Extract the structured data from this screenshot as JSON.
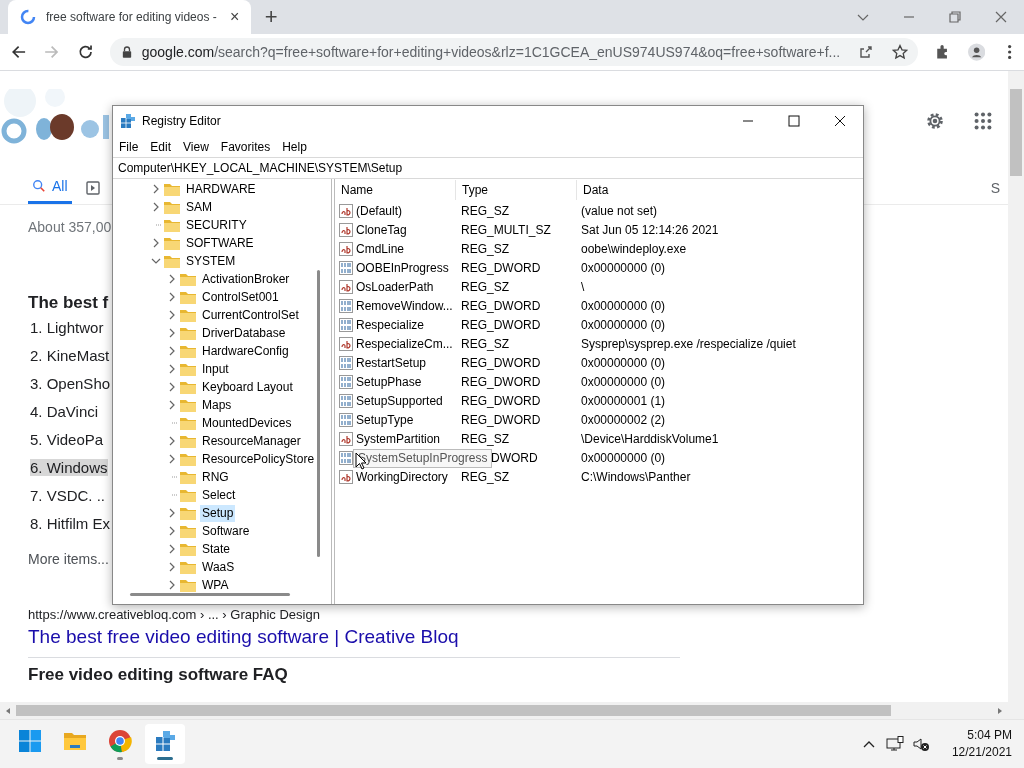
{
  "browser": {
    "tab": {
      "title": "free software for editing videos -",
      "close": "×"
    },
    "new_tab": "+",
    "forward_disabled": true,
    "address": {
      "host": "google.com",
      "path": "/search?q=free+software+for+editing+videos&rlz=1C1GCEA_enUS974US974&oq=free+software+f..."
    }
  },
  "google": {
    "tabs": [
      {
        "label": "All",
        "selected": true
      }
    ],
    "cut_tab": "S",
    "result_count": "About 357,00",
    "heading": "The best f",
    "list": [
      "1. Lightwor",
      "2. KineMast",
      "3. OpenSho",
      "4. DaVinci",
      "5. VideoPa",
      "6. Windows",
      "7. VSDC. ..",
      "8. Hitfilm Ex"
    ],
    "highlighted": [
      false,
      false,
      false,
      false,
      false,
      true,
      false,
      false
    ],
    "more": "More items...",
    "url": "https://www.creativebloq.com › ... › Graphic Design",
    "link": "The best free video editing software | Creative Bloq",
    "faq": "Free video editing software FAQ"
  },
  "regedit": {
    "title": "Registry Editor",
    "menu": [
      "File",
      "Edit",
      "View",
      "Favorites",
      "Help"
    ],
    "address": "Computer\\HKEY_LOCAL_MACHINE\\SYSTEM\\Setup",
    "tree": [
      {
        "label": "HARDWARE",
        "expandable": true,
        "expanded": false,
        "selected": false
      },
      {
        "label": "SAM",
        "expandable": true,
        "expanded": false,
        "selected": false
      },
      {
        "label": "SECURITY",
        "expandable": false,
        "expanded": false,
        "selected": false
      },
      {
        "label": "SOFTWARE",
        "expandable": true,
        "expanded": false,
        "selected": false
      },
      {
        "label": "SYSTEM",
        "expandable": true,
        "expanded": true,
        "selected": false,
        "children": [
          {
            "label": "ActivationBroker",
            "expandable": true,
            "expanded": false,
            "selected": false
          },
          {
            "label": "ControlSet001",
            "expandable": true,
            "expanded": false,
            "selected": false
          },
          {
            "label": "CurrentControlSet",
            "expandable": true,
            "expanded": false,
            "selected": false
          },
          {
            "label": "DriverDatabase",
            "expandable": true,
            "expanded": false,
            "selected": false
          },
          {
            "label": "HardwareConfig",
            "expandable": true,
            "expanded": false,
            "selected": false
          },
          {
            "label": "Input",
            "expandable": true,
            "expanded": false,
            "selected": false
          },
          {
            "label": "Keyboard Layout",
            "expandable": true,
            "expanded": false,
            "selected": false
          },
          {
            "label": "Maps",
            "expandable": true,
            "expanded": false,
            "selected": false
          },
          {
            "label": "MountedDevices",
            "expandable": false,
            "expanded": false,
            "selected": false
          },
          {
            "label": "ResourceManager",
            "expandable": true,
            "expanded": false,
            "selected": false
          },
          {
            "label": "ResourcePolicyStore",
            "expandable": true,
            "expanded": false,
            "selected": false
          },
          {
            "label": "RNG",
            "expandable": false,
            "expanded": false,
            "selected": false
          },
          {
            "label": "Select",
            "expandable": false,
            "expanded": false,
            "selected": false
          },
          {
            "label": "Setup",
            "expandable": true,
            "expanded": false,
            "selected": true
          },
          {
            "label": "Software",
            "expandable": true,
            "expanded": false,
            "selected": false
          },
          {
            "label": "State",
            "expandable": true,
            "expanded": false,
            "selected": false
          },
          {
            "label": "WaaS",
            "expandable": true,
            "expanded": false,
            "selected": false
          },
          {
            "label": "WPA",
            "expandable": true,
            "expanded": false,
            "selected": false
          }
        ]
      }
    ],
    "columns": [
      "Name",
      "Type",
      "Data"
    ],
    "rows": [
      {
        "kind": "string",
        "name": "(Default)",
        "type": "REG_SZ",
        "data": "(value not set)"
      },
      {
        "kind": "string",
        "name": "CloneTag",
        "type": "REG_MULTI_SZ",
        "data": "Sat Jun 05 12:14:26 2021"
      },
      {
        "kind": "string",
        "name": "CmdLine",
        "type": "REG_SZ",
        "data": "oobe\\windeploy.exe"
      },
      {
        "kind": "binary",
        "name": "OOBEInProgress",
        "type": "REG_DWORD",
        "data": "0x00000000 (0)"
      },
      {
        "kind": "string",
        "name": "OsLoaderPath",
        "type": "REG_SZ",
        "data": "\\"
      },
      {
        "kind": "binary",
        "name": "RemoveWindow...",
        "type": "REG_DWORD",
        "data": "0x00000000 (0)"
      },
      {
        "kind": "binary",
        "name": "Respecialize",
        "type": "REG_DWORD",
        "data": "0x00000000 (0)"
      },
      {
        "kind": "string",
        "name": "RespecializeCm...",
        "type": "REG_SZ",
        "data": "Sysprep\\sysprep.exe /respecialize /quiet"
      },
      {
        "kind": "binary",
        "name": "RestartSetup",
        "type": "REG_DWORD",
        "data": "0x00000000 (0)"
      },
      {
        "kind": "binary",
        "name": "SetupPhase",
        "type": "REG_DWORD",
        "data": "0x00000000 (0)"
      },
      {
        "kind": "binary",
        "name": "SetupSupported",
        "type": "REG_DWORD",
        "data": "0x00000001 (1)"
      },
      {
        "kind": "binary",
        "name": "SetupType",
        "type": "REG_DWORD",
        "data": "0x00000002 (2)"
      },
      {
        "kind": "string",
        "name": "SystemPartition",
        "type": "REG_SZ",
        "data": "\\Device\\HarddiskVolume1"
      },
      {
        "kind": "binary",
        "tooltip": "SystemSetupInProgress",
        "type": "DWORD",
        "data": "0x00000000 (0)"
      },
      {
        "kind": "string",
        "name": "WorkingDirectory",
        "type": "REG_SZ",
        "data": "C:\\Windows\\Panther"
      }
    ]
  },
  "taskbar": {
    "apps": [
      {
        "kind": "start",
        "running": false,
        "active": false
      },
      {
        "kind": "explorer",
        "running": false,
        "active": false
      },
      {
        "kind": "chrome",
        "running": true,
        "active": false
      },
      {
        "kind": "regedit",
        "running": true,
        "active": true
      }
    ],
    "time": "5:04 PM",
    "date": "12/21/2021"
  }
}
